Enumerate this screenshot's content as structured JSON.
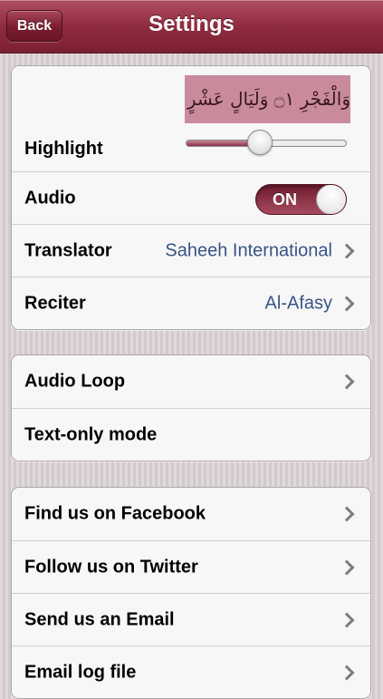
{
  "nav": {
    "title": "Settings",
    "back_label": "Back"
  },
  "colors": {
    "nav_bar": "#8f2c3f",
    "accent": "#9a3c52",
    "value_text": "#385487",
    "background": "#d9d0d6"
  },
  "settings_group_1": {
    "highlight": {
      "label": "Highlight",
      "sample_text": "وَالْفَجْرِ ۝١ وَلَيَالٍ عَشْرٍ ۝٢",
      "slider_level": 0.46
    },
    "audio": {
      "label": "Audio",
      "toggle_label": "ON",
      "toggle_on": true
    },
    "translator": {
      "label": "Translator",
      "value": "Saheeh International",
      "icon": "chevron-right-icon"
    },
    "reciter": {
      "label": "Reciter",
      "value": "Al-Afasy",
      "icon": "chevron-right-icon"
    }
  },
  "settings_group_2": {
    "audio_loop": {
      "label": "Audio Loop",
      "icon": "chevron-right-icon"
    },
    "text_only_mode": {
      "label": "Text-only mode"
    }
  },
  "settings_group_3": {
    "facebook": {
      "label": "Find us on Facebook",
      "icon": "chevron-right-icon"
    },
    "twitter": {
      "label": "Follow us on Twitter",
      "icon": "chevron-right-icon"
    },
    "email": {
      "label": "Send us an Email",
      "icon": "chevron-right-icon"
    },
    "log_file": {
      "label": "Email log file",
      "icon": "chevron-right-icon"
    }
  }
}
